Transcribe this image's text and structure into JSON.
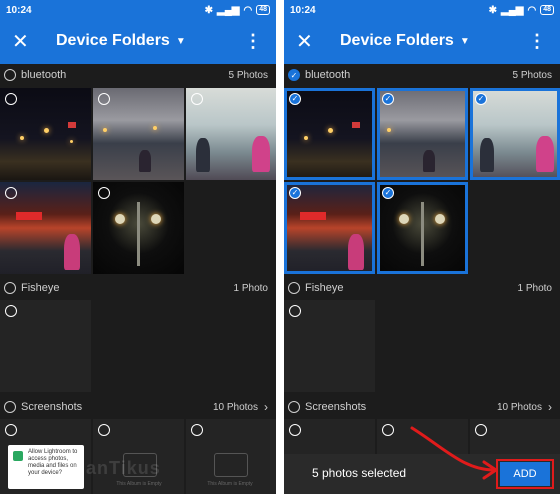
{
  "left": {
    "status": {
      "time": "10:24",
      "battery": "48"
    },
    "toolbar": {
      "title": "Device Folders"
    },
    "sections": [
      {
        "name": "bluetooth",
        "count": "5 Photos"
      },
      {
        "name": "Fisheye",
        "count": "1 Photo"
      },
      {
        "name": "Screenshots",
        "count": "10 Photos"
      }
    ],
    "screenshot_thumb": {
      "text": "Allow Lightroom to access photos, media and files on your device?"
    },
    "placeholder_texts": [
      "This Album is Empty",
      "This Album is Empty"
    ],
    "watermark": "JalanTikus"
  },
  "right": {
    "status": {
      "time": "10:24",
      "battery": "48"
    },
    "toolbar": {
      "title": "Device Folders"
    },
    "sections": [
      {
        "name": "bluetooth",
        "count": "5 Photos"
      },
      {
        "name": "Fisheye",
        "count": "1 Photo"
      },
      {
        "name": "Screenshots",
        "count": "10 Photos"
      }
    ],
    "bottombar": {
      "text": "5 photos selected",
      "add_label": "ADD"
    }
  },
  "colors": {
    "accent": "#1a73d9",
    "background": "#1c1c1c",
    "highlight": "#e01b1b"
  },
  "icons": [
    "close-icon",
    "dropdown-caret-icon",
    "more-vertical-icon",
    "bluetooth-icon",
    "wifi-icon",
    "battery-icon",
    "chevron-right-icon"
  ]
}
